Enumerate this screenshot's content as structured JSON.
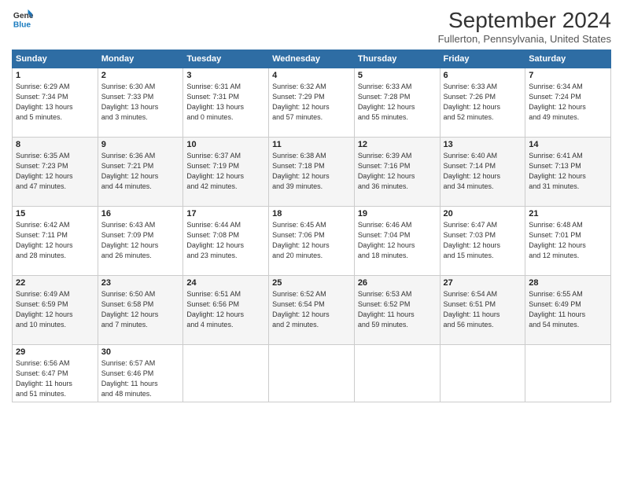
{
  "header": {
    "logo_line1": "General",
    "logo_line2": "Blue",
    "month_title": "September 2024",
    "subtitle": "Fullerton, Pennsylvania, United States"
  },
  "weekdays": [
    "Sunday",
    "Monday",
    "Tuesday",
    "Wednesday",
    "Thursday",
    "Friday",
    "Saturday"
  ],
  "weeks": [
    [
      {
        "day": "1",
        "info": "Sunrise: 6:29 AM\nSunset: 7:34 PM\nDaylight: 13 hours\nand 5 minutes."
      },
      {
        "day": "2",
        "info": "Sunrise: 6:30 AM\nSunset: 7:33 PM\nDaylight: 13 hours\nand 3 minutes."
      },
      {
        "day": "3",
        "info": "Sunrise: 6:31 AM\nSunset: 7:31 PM\nDaylight: 13 hours\nand 0 minutes."
      },
      {
        "day": "4",
        "info": "Sunrise: 6:32 AM\nSunset: 7:29 PM\nDaylight: 12 hours\nand 57 minutes."
      },
      {
        "day": "5",
        "info": "Sunrise: 6:33 AM\nSunset: 7:28 PM\nDaylight: 12 hours\nand 55 minutes."
      },
      {
        "day": "6",
        "info": "Sunrise: 6:33 AM\nSunset: 7:26 PM\nDaylight: 12 hours\nand 52 minutes."
      },
      {
        "day": "7",
        "info": "Sunrise: 6:34 AM\nSunset: 7:24 PM\nDaylight: 12 hours\nand 49 minutes."
      }
    ],
    [
      {
        "day": "8",
        "info": "Sunrise: 6:35 AM\nSunset: 7:23 PM\nDaylight: 12 hours\nand 47 minutes."
      },
      {
        "day": "9",
        "info": "Sunrise: 6:36 AM\nSunset: 7:21 PM\nDaylight: 12 hours\nand 44 minutes."
      },
      {
        "day": "10",
        "info": "Sunrise: 6:37 AM\nSunset: 7:19 PM\nDaylight: 12 hours\nand 42 minutes."
      },
      {
        "day": "11",
        "info": "Sunrise: 6:38 AM\nSunset: 7:18 PM\nDaylight: 12 hours\nand 39 minutes."
      },
      {
        "day": "12",
        "info": "Sunrise: 6:39 AM\nSunset: 7:16 PM\nDaylight: 12 hours\nand 36 minutes."
      },
      {
        "day": "13",
        "info": "Sunrise: 6:40 AM\nSunset: 7:14 PM\nDaylight: 12 hours\nand 34 minutes."
      },
      {
        "day": "14",
        "info": "Sunrise: 6:41 AM\nSunset: 7:13 PM\nDaylight: 12 hours\nand 31 minutes."
      }
    ],
    [
      {
        "day": "15",
        "info": "Sunrise: 6:42 AM\nSunset: 7:11 PM\nDaylight: 12 hours\nand 28 minutes."
      },
      {
        "day": "16",
        "info": "Sunrise: 6:43 AM\nSunset: 7:09 PM\nDaylight: 12 hours\nand 26 minutes."
      },
      {
        "day": "17",
        "info": "Sunrise: 6:44 AM\nSunset: 7:08 PM\nDaylight: 12 hours\nand 23 minutes."
      },
      {
        "day": "18",
        "info": "Sunrise: 6:45 AM\nSunset: 7:06 PM\nDaylight: 12 hours\nand 20 minutes."
      },
      {
        "day": "19",
        "info": "Sunrise: 6:46 AM\nSunset: 7:04 PM\nDaylight: 12 hours\nand 18 minutes."
      },
      {
        "day": "20",
        "info": "Sunrise: 6:47 AM\nSunset: 7:03 PM\nDaylight: 12 hours\nand 15 minutes."
      },
      {
        "day": "21",
        "info": "Sunrise: 6:48 AM\nSunset: 7:01 PM\nDaylight: 12 hours\nand 12 minutes."
      }
    ],
    [
      {
        "day": "22",
        "info": "Sunrise: 6:49 AM\nSunset: 6:59 PM\nDaylight: 12 hours\nand 10 minutes."
      },
      {
        "day": "23",
        "info": "Sunrise: 6:50 AM\nSunset: 6:58 PM\nDaylight: 12 hours\nand 7 minutes."
      },
      {
        "day": "24",
        "info": "Sunrise: 6:51 AM\nSunset: 6:56 PM\nDaylight: 12 hours\nand 4 minutes."
      },
      {
        "day": "25",
        "info": "Sunrise: 6:52 AM\nSunset: 6:54 PM\nDaylight: 12 hours\nand 2 minutes."
      },
      {
        "day": "26",
        "info": "Sunrise: 6:53 AM\nSunset: 6:52 PM\nDaylight: 11 hours\nand 59 minutes."
      },
      {
        "day": "27",
        "info": "Sunrise: 6:54 AM\nSunset: 6:51 PM\nDaylight: 11 hours\nand 56 minutes."
      },
      {
        "day": "28",
        "info": "Sunrise: 6:55 AM\nSunset: 6:49 PM\nDaylight: 11 hours\nand 54 minutes."
      }
    ],
    [
      {
        "day": "29",
        "info": "Sunrise: 6:56 AM\nSunset: 6:47 PM\nDaylight: 11 hours\nand 51 minutes."
      },
      {
        "day": "30",
        "info": "Sunrise: 6:57 AM\nSunset: 6:46 PM\nDaylight: 11 hours\nand 48 minutes."
      },
      {
        "day": "",
        "info": ""
      },
      {
        "day": "",
        "info": ""
      },
      {
        "day": "",
        "info": ""
      },
      {
        "day": "",
        "info": ""
      },
      {
        "day": "",
        "info": ""
      }
    ]
  ]
}
